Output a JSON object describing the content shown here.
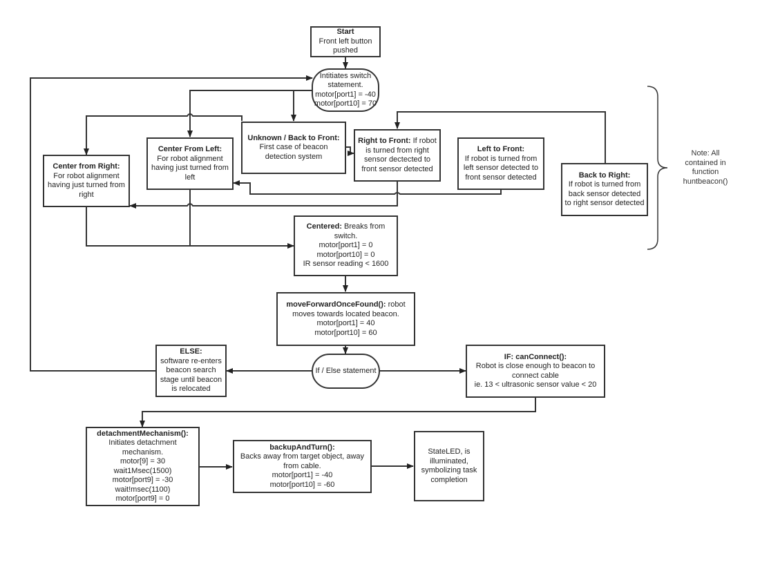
{
  "diagram": {
    "nodes": {
      "start": {
        "title": "Start",
        "lines": [
          "Front left button",
          "pushed"
        ]
      },
      "switch": {
        "lines": [
          "Intitiates switch",
          "statement.",
          "motor[port1] = -40",
          "motor[port10] = 70"
        ]
      },
      "center_right": {
        "title": "Center from Right:",
        "lines": [
          "For robot alignment",
          "having just turned from",
          "right"
        ]
      },
      "center_left": {
        "title": "Center From Left:",
        "lines": [
          "For robot alignment",
          "having just turned from",
          "left"
        ]
      },
      "unknown": {
        "title": "Unknown / Back to Front:",
        "lines": [
          "First case of beacon",
          "detection system"
        ]
      },
      "right_front": {
        "title": "Right to Front:",
        "title_rest": " If robot",
        "lines": [
          "is turned from right",
          "sensor dectected to",
          "front sensor detected"
        ]
      },
      "left_front": {
        "title": "Left to Front:",
        "lines": [
          "If robot is turned from",
          "left sensor detected to",
          "front sensor detected"
        ]
      },
      "back_right": {
        "title": "Back to Right:",
        "lines": [
          "If robot is turned from",
          "back sensor detected",
          "to right sensor detected"
        ]
      },
      "centered": {
        "title": "Centered:",
        "title_rest": " Breaks from",
        "lines": [
          "switch.",
          "motor[port1] = 0",
          "motor[port10] = 0",
          "IR sensor reading < 1600"
        ]
      },
      "move_forward": {
        "title": "moveForwardOnceFound():",
        "title_rest": " robot",
        "lines": [
          "moves towards located beacon.",
          "motor[port1] = 40",
          "motor[port10] = 60"
        ]
      },
      "if_else": {
        "lines": [
          "If / Else statement"
        ]
      },
      "else": {
        "title": "ELSE:",
        "lines": [
          "software re-enters",
          "beacon search",
          "stage until beacon",
          "is relocated"
        ]
      },
      "if_connect": {
        "title": "IF: canConnect():",
        "lines": [
          "Robot is close enough to beacon to",
          "connect cable",
          "ie.   13 < ultrasonic sensor value < 20"
        ]
      },
      "detach": {
        "title": "detachmentMechanism():",
        "lines": [
          "Initiates detachment",
          "mechanism.",
          "motor[9] = 30",
          "wait1Msec(1500)",
          "motor[port9] = -30",
          "wait!msec(1100)",
          "motor[port9] = 0"
        ]
      },
      "backup": {
        "title": "backupAndTurn():",
        "lines": [
          "Backs away from target object, away",
          "from cable.",
          "motor[port1] = -40",
          "motor[port10] = -60"
        ]
      },
      "stateled": {
        "lines": [
          "StateLED, is",
          "illuminated,",
          "symbolizing task",
          "completion"
        ]
      }
    },
    "note": {
      "lines": [
        "Note: All",
        "contained in",
        "function",
        "huntbeacon()"
      ]
    },
    "colors": {
      "stroke": "#333333",
      "background": "#ffffff",
      "text": "#222222"
    }
  }
}
